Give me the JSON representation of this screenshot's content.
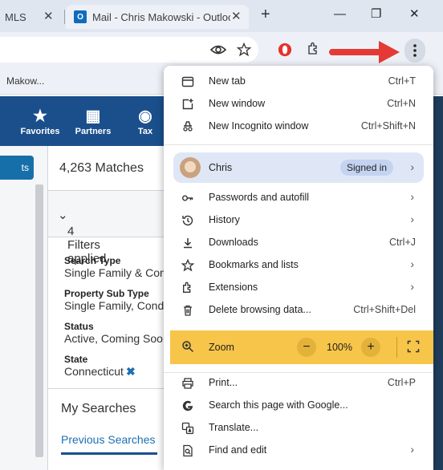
{
  "browser": {
    "tabs": [
      {
        "title": "MLS",
        "close": "✕"
      },
      {
        "title": "Mail - Chris Makowski - Outlook",
        "close": "✕"
      }
    ],
    "new_tab": "+",
    "window_controls": {
      "minimize": "—",
      "restore": "❐",
      "close": "✕"
    },
    "bookmark_text": "Makow...",
    "toolbar_icons": [
      "eye-icon",
      "star-icon",
      "opera-icon",
      "extensions-icon",
      "menu-kebab-icon"
    ],
    "annotation_color": "#e53935"
  },
  "page": {
    "nav": [
      {
        "label": "Favorites",
        "icon": "★"
      },
      {
        "label": "Partners",
        "icon": "▦"
      },
      {
        "label": "Tax",
        "icon": "◉"
      }
    ],
    "left_button": "ts",
    "matches": "4,263 Matches",
    "filters": "4 Filters applied",
    "criteria": [
      {
        "label": "Search Type",
        "value": "Single Family & Con"
      },
      {
        "label": "Property Sub Type",
        "value": "Single Family, Cond"
      },
      {
        "label": "Status",
        "value": "Active, Coming Soon"
      },
      {
        "label": "State",
        "value": "Connecticut"
      }
    ],
    "remove_icon": "✖",
    "my_searches_title": "My Searches",
    "previous_searches": "Previous Searches",
    "brand_color": "#1b4f8c"
  },
  "menu": {
    "new_tab": {
      "label": "New tab",
      "shortcut": "Ctrl+T"
    },
    "new_window": {
      "label": "New window",
      "shortcut": "Ctrl+N"
    },
    "incognito": {
      "label": "New Incognito window",
      "shortcut": "Ctrl+Shift+N"
    },
    "profile": {
      "name": "Chris",
      "status": "Signed in"
    },
    "passwords": {
      "label": "Passwords and autofill"
    },
    "history": {
      "label": "History"
    },
    "downloads": {
      "label": "Downloads",
      "shortcut": "Ctrl+J"
    },
    "bookmarks": {
      "label": "Bookmarks and lists"
    },
    "extensions": {
      "label": "Extensions"
    },
    "delete_data": {
      "label": "Delete browsing data...",
      "shortcut": "Ctrl+Shift+Del"
    },
    "zoom": {
      "label": "Zoom",
      "minus": "−",
      "value": "100%",
      "plus": "+",
      "highlight_color": "#f7c54a"
    },
    "print": {
      "label": "Print...",
      "shortcut": "Ctrl+P"
    },
    "search_google": {
      "label": "Search this page with Google..."
    },
    "translate": {
      "label": "Translate..."
    },
    "find_edit": {
      "label": "Find and edit"
    },
    "chevron": "›"
  }
}
